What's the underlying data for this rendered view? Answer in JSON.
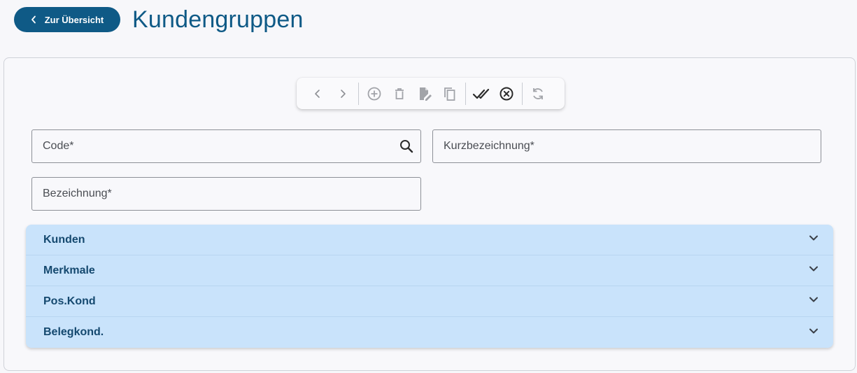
{
  "header": {
    "back_label": "Zur Übersicht",
    "title": "Kundengruppen"
  },
  "toolbar": {
    "buttons": [
      {
        "name": "previous",
        "icon": "chevron-left-icon",
        "enabled": false
      },
      {
        "name": "next",
        "icon": "chevron-right-icon",
        "enabled": false
      },
      {
        "name": "add",
        "icon": "plus-circle-icon",
        "enabled": false
      },
      {
        "name": "delete",
        "icon": "trash-icon",
        "enabled": false
      },
      {
        "name": "edit",
        "icon": "file-edit-icon",
        "enabled": false
      },
      {
        "name": "copy",
        "icon": "copy-icon",
        "enabled": false
      },
      {
        "name": "save",
        "icon": "check-double-icon",
        "enabled": true
      },
      {
        "name": "cancel",
        "icon": "x-circle-icon",
        "enabled": true
      },
      {
        "name": "refresh",
        "icon": "refresh-icon",
        "enabled": false
      }
    ]
  },
  "form": {
    "code": {
      "placeholder": "Code*",
      "value": ""
    },
    "kurzbezeichnung": {
      "placeholder": "Kurzbezeichnung*",
      "value": ""
    },
    "bezeichnung": {
      "placeholder": "Bezeichnung*",
      "value": ""
    }
  },
  "accordion": {
    "items": [
      {
        "label": "Kunden"
      },
      {
        "label": "Merkmale"
      },
      {
        "label": "Pos.Kond"
      },
      {
        "label": "Belegkond."
      }
    ]
  },
  "colors": {
    "brand": "#0f5a86",
    "accordion_bg": "#c9e3fb",
    "accordion_text": "#15496f",
    "icon_disabled": "#a7a9ae",
    "icon_enabled": "#2b2b2b"
  }
}
